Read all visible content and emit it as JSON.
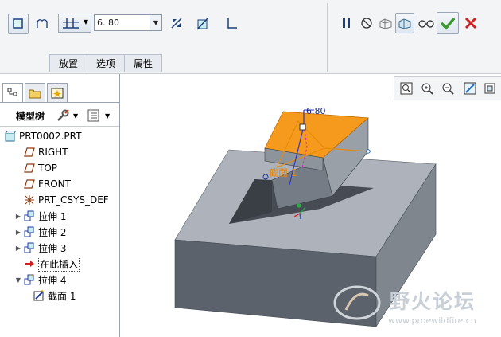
{
  "dashboard": {
    "depth_value": "6. 80",
    "tabs": [
      "放置",
      "选项",
      "属性"
    ]
  },
  "tree": {
    "title": "模型树",
    "items": [
      {
        "label": "PRT0002.PRT",
        "icon": "part-icon",
        "expandable": false,
        "indent": 0
      },
      {
        "label": "RIGHT",
        "icon": "datum-plane-icon",
        "expandable": false,
        "indent": 1
      },
      {
        "label": "TOP",
        "icon": "datum-plane-icon",
        "expandable": false,
        "indent": 1
      },
      {
        "label": "FRONT",
        "icon": "datum-plane-icon",
        "expandable": false,
        "indent": 1
      },
      {
        "label": "PRT_CSYS_DEF",
        "icon": "csys-icon",
        "expandable": false,
        "indent": 1
      },
      {
        "label": "拉伸 1",
        "icon": "extrude-icon",
        "expandable": true,
        "indent": 1
      },
      {
        "label": "拉伸 2",
        "icon": "extrude-icon",
        "expandable": true,
        "indent": 1
      },
      {
        "label": "拉伸 3",
        "icon": "extrude-icon",
        "expandable": true,
        "indent": 1
      },
      {
        "label": "在此插入",
        "icon": "insert-arrow-icon",
        "expandable": false,
        "indent": 1
      },
      {
        "label": "拉伸 4",
        "icon": "extrude-new-icon",
        "expandable": true,
        "expanded": true,
        "indent": 1
      },
      {
        "label": "截面 1",
        "icon": "sketch-icon",
        "expandable": false,
        "indent": 2
      }
    ]
  },
  "viewport": {
    "dimension_label": "6.80",
    "section_label": "截面 1"
  },
  "watermark": {
    "title": "野火论坛",
    "url": "www.proewildfire.cn"
  },
  "colors": {
    "model_top": "#aeb3bb",
    "model_front": "#5c626b",
    "model_side": "#848a92",
    "preview_orange": "#f59a1c",
    "accent_blue": "#1f3c9c",
    "ok_green": "#3a9a2e",
    "cancel_red": "#d11f1f"
  }
}
